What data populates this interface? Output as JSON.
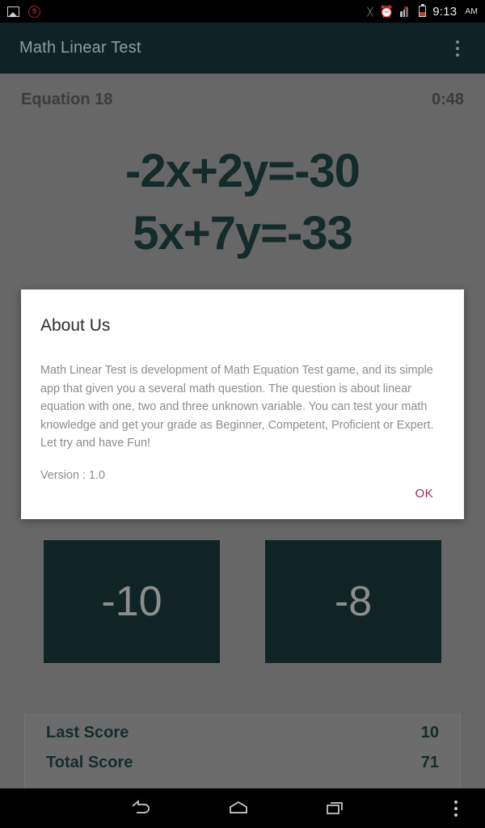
{
  "statusbar": {
    "notification_badge": "9",
    "time": "9:13",
    "ampm": "AM",
    "icons": [
      "image-icon",
      "notification-count-badge",
      "bluetooth-icon",
      "alarm-icon",
      "signal-icon",
      "battery-icon"
    ]
  },
  "appbar": {
    "title": "Math Linear Test",
    "overflow_icon": "overflow-menu-icon"
  },
  "quiz": {
    "equation_label": "Equation 18",
    "timer": "0:48",
    "equations": [
      "-2x+2y=-30",
      "5x+7y=-33"
    ],
    "answers": [
      "-10",
      "-8"
    ]
  },
  "scores": {
    "rows": [
      {
        "label": "Last Score",
        "value": "10"
      },
      {
        "label": "Total Score",
        "value": "71"
      }
    ]
  },
  "dialog": {
    "title": "About Us",
    "body": "Math Linear Test is development of Math Equation Test game, and its simple app that given you a several math question. The question is about linear equation with one, two and three unknown variable. You can test your math knowledge and get your grade as Beginner, Competent, Proficient or Expert. Let try and have Fun!",
    "version": "Version : 1.0",
    "ok_label": "OK",
    "ok_color": "#9c2b4e"
  },
  "navbar": {
    "back_icon": "back-arrow-icon",
    "home_icon": "home-icon",
    "recents_icon": "recent-apps-icon",
    "overflow_icon": "overflow-menu-icon"
  },
  "theme": {
    "appbar_color": "#0f2326",
    "answer_button_color": "#102425",
    "scrim_color": "#676767"
  }
}
